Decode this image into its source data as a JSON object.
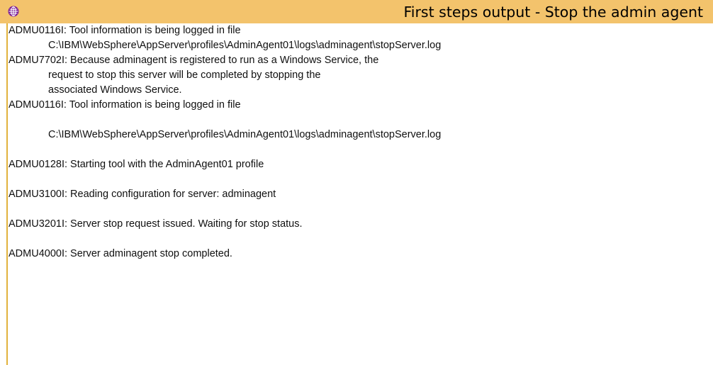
{
  "window": {
    "title": "First steps output  - Stop the admin agent",
    "icon": "globe-icon",
    "colors": {
      "title_bar": "#f3c36c",
      "left_border": "#e2b23c",
      "background": "#ffffff",
      "text": "#101010"
    }
  },
  "output": {
    "lines": [
      "ADMU0116I: Tool information is being logged in file",
      "C:\\IBM\\WebSphere\\AppServer\\profiles\\AdminAgent01\\logs\\adminagent\\stopServer.log",
      "ADMU7702I: Because adminagent is registered to run as a Windows Service, the",
      "request to stop this server will be completed by stopping the",
      "associated Windows Service.",
      "ADMU0116I: Tool information is being logged in file",
      "",
      "C:\\IBM\\WebSphere\\AppServer\\profiles\\AdminAgent01\\logs\\adminagent\\stopServer.log",
      "",
      "ADMU0128I: Starting tool with the AdminAgent01 profile",
      "",
      "ADMU3100I: Reading configuration for server: adminagent",
      "",
      "ADMU3201I: Server stop request issued. Waiting for stop status.",
      "",
      "ADMU4000I: Server adminagent stop completed."
    ]
  }
}
